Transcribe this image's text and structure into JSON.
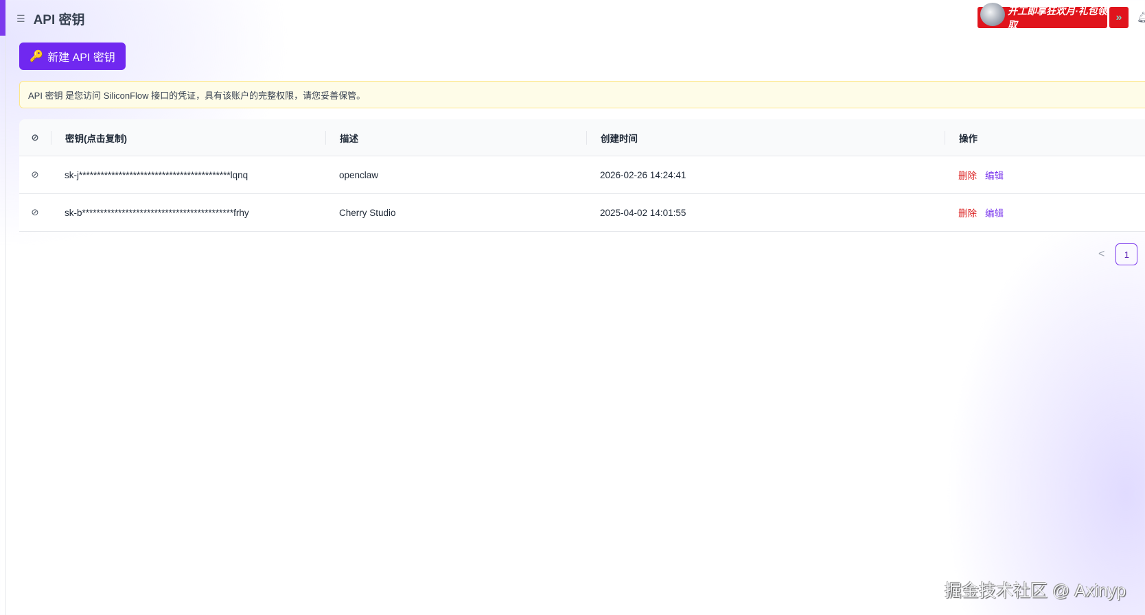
{
  "header": {
    "title": "API 密钥",
    "menu_icon": "menu-fold-icon"
  },
  "banner": {
    "text": "开工即享狂欢月·礼包领取",
    "arrow": "»"
  },
  "toolbar": {
    "new_key_label": "新建 API 密钥",
    "new_key_icon": "🔑"
  },
  "notice": "API 密钥 是您访问 SiliconFlow 接口的凭证，具有该账户的完整权限，请您妥善保管。",
  "table": {
    "headers": [
      "密钥(点击复制)",
      "描述",
      "创建时间",
      "操作"
    ],
    "rows": [
      {
        "key": "sk-j******************************************lqnq",
        "desc": "openclaw",
        "created": "2026-02-26 14:24:41",
        "delete": "删除",
        "edit": "编辑"
      },
      {
        "key": "sk-b******************************************frhy",
        "desc": "Cherry Studio",
        "created": "2025-04-02 14:01:55",
        "delete": "删除",
        "edit": "编辑"
      }
    ]
  },
  "pagination": {
    "prev": "<",
    "current": "1"
  },
  "watermark": "掘金技术社区 @ Axinyp",
  "colors": {
    "accent": "#7028f0",
    "danger": "#dc2626",
    "notice_bg": "#fefce8"
  }
}
